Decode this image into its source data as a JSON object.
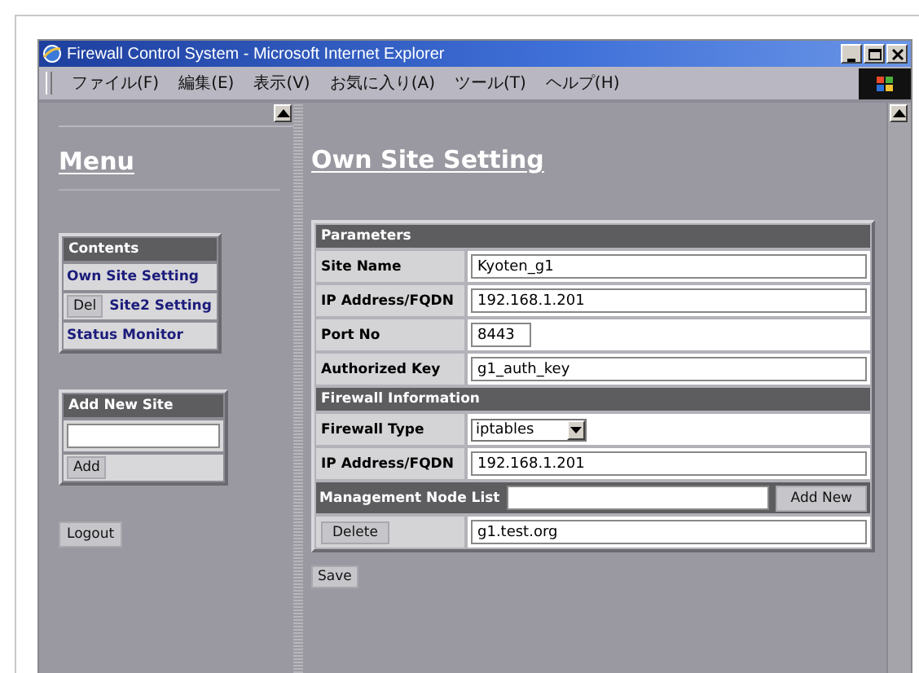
{
  "window": {
    "title": "Firewall Control System - Microsoft Internet Explorer"
  },
  "menu_bar": [
    "ファイル(F)",
    "編集(E)",
    "表示(V)",
    "お気に入り(A)",
    "ツール(T)",
    "ヘルプ(H)"
  ],
  "menu_frame": {
    "heading": "Menu",
    "contents": {
      "title": "Contents",
      "items": [
        {
          "kind": "link",
          "label": "Own Site Setting"
        },
        {
          "kind": "site",
          "button": "Del",
          "label": "Site2 Setting"
        },
        {
          "kind": "link",
          "label": "Status Monitor"
        }
      ]
    },
    "add_site": {
      "title": "Add New Site",
      "button": "Add"
    },
    "logout": "Logout"
  },
  "main_frame": {
    "heading": "Own Site Setting",
    "sections": [
      {
        "title": "Parameters",
        "rows": [
          {
            "kind": "text",
            "label": "Site Name",
            "value": "Kyoten_g1"
          },
          {
            "kind": "text",
            "label": "IP Address/FQDN",
            "value": "192.168.1.201"
          },
          {
            "kind": "short",
            "label": "Port No",
            "value": "8443"
          },
          {
            "kind": "text",
            "label": "Authorized Key",
            "value": "g1_auth_key"
          }
        ]
      },
      {
        "title": "Firewall Information",
        "rows": [
          {
            "kind": "select",
            "label": "Firewall Type",
            "value": "iptables"
          },
          {
            "kind": "text",
            "label": "IP Address/FQDN",
            "value": "192.168.1.201"
          },
          {
            "kind": "add",
            "label": "Management Node List",
            "button": "Add New"
          },
          {
            "kind": "node",
            "button": "Delete",
            "value": "g1.test.org"
          }
        ]
      }
    ],
    "save": "Save"
  }
}
